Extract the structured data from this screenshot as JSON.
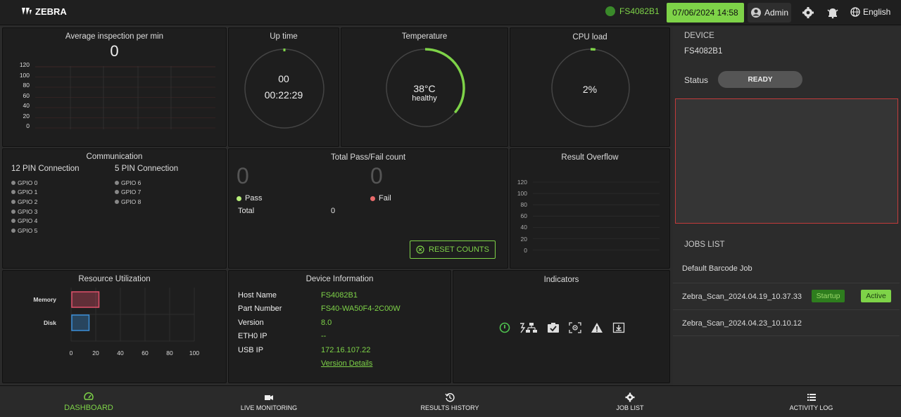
{
  "header": {
    "logo": "ZEBRA",
    "device_id": "FS4082B1",
    "datetime": "07/06/2024 14:58",
    "user": "Admin",
    "language": "English"
  },
  "avg_inspection": {
    "title": "Average inspection per min",
    "value": "0",
    "y_ticks": [
      "120",
      "100",
      "80",
      "60",
      "40",
      "20",
      "0"
    ]
  },
  "uptime": {
    "title": "Up time",
    "days": "00",
    "time": "00:22:29"
  },
  "temperature": {
    "title": "Temperature",
    "value": "38°C",
    "state": "healthy",
    "level": 0.36
  },
  "cpu": {
    "title": "CPU load",
    "value": "2%",
    "level": 0.02
  },
  "communication": {
    "title": "Communication",
    "group1_title": "12 PIN Connection",
    "group1": [
      "GPIO 0",
      "GPIO 1",
      "GPIO 2",
      "GPIO 3",
      "GPIO 4",
      "GPIO 5"
    ],
    "group2_title": "5 PIN Connection",
    "group2": [
      "GPIO 6",
      "GPIO 7",
      "GPIO 8"
    ]
  },
  "passfail": {
    "title": "Total Pass/Fail count",
    "pass_count": "0",
    "fail_count": "0",
    "pass_label": "Pass",
    "fail_label": "Fail",
    "total_label": "Total",
    "total_value": "0",
    "reset_label": "RESET COUNTS"
  },
  "overflow": {
    "title": "Result Overflow",
    "y_ticks": [
      "120",
      "100",
      "80",
      "60",
      "40",
      "20",
      "0"
    ]
  },
  "resources": {
    "title": "Resource Utilization",
    "rows": [
      {
        "label": "Memory",
        "value": 22,
        "color": "#e0506a"
      },
      {
        "label": "Disk",
        "value": 14,
        "color": "#3b8fd8"
      }
    ],
    "x_ticks": [
      "0",
      "20",
      "40",
      "60",
      "80",
      "100"
    ]
  },
  "device_info": {
    "title": "Device Information",
    "rows": [
      {
        "key": "Host Name",
        "value": "FS4082B1"
      },
      {
        "key": "Part Number",
        "value": "FS40-WA50F4-2C00W"
      },
      {
        "key": "Version",
        "value": "8.0"
      },
      {
        "key": "ETH0 IP",
        "value": "--"
      },
      {
        "key": "USB IP",
        "value": "172.16.107.22"
      }
    ],
    "link": "Version Details"
  },
  "indicators": {
    "title": "Indicators"
  },
  "sidebar": {
    "device_label": "DEVICE",
    "device_name": "FS4082B1",
    "status_label": "Status",
    "status_value": "READY",
    "jobs_label": "JOBS LIST",
    "default_job": "Default Barcode Job",
    "jobs": [
      {
        "name": "Zebra_Scan_2024.04.19_10.37.33",
        "badge1": "Startup",
        "badge2": "Active"
      },
      {
        "name": "Zebra_Scan_2024.04.23_10.10.12"
      }
    ]
  },
  "nav": {
    "dashboard": "DASHBOARD",
    "live": "LIVE MONITORING",
    "history": "RESULTS HISTORY",
    "jobs": "JOB LIST",
    "activity": "ACTIVITY LOG"
  },
  "colors": {
    "accent": "#7ed348",
    "pass": "#b8f07a",
    "fail": "#e86a6a"
  }
}
